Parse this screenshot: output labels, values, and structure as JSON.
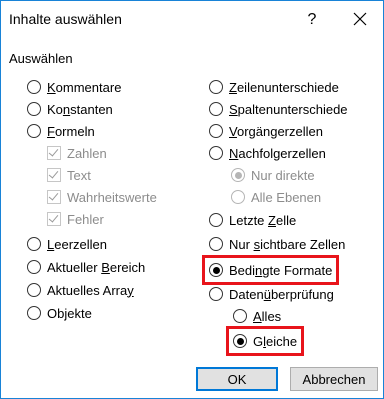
{
  "window": {
    "title": "Inhalte auswählen",
    "help": "?",
    "close_icon": "close-icon"
  },
  "group": {
    "label": "Auswählen"
  },
  "left_options": [
    {
      "pre": "",
      "u": "K",
      "post": "ommentare"
    },
    {
      "pre": "Ko",
      "u": "n",
      "post": "stanten"
    },
    {
      "pre": "",
      "u": "F",
      "post": "ormeln"
    },
    {
      "label": "Zahlen"
    },
    {
      "label": "Text"
    },
    {
      "label": "Wahrheitswerte"
    },
    {
      "label": "Fehler"
    },
    {
      "pre": "",
      "u": "L",
      "post": "eerzellen"
    },
    {
      "pre": "Aktueller ",
      "u": "B",
      "post": "ereich"
    },
    {
      "pre": "Aktuelles Arra",
      "u": "y",
      "post": ""
    },
    {
      "pre": "Ob",
      "u": "j",
      "post": "ekte"
    }
  ],
  "right_options": [
    {
      "pre": "",
      "u": "Z",
      "post": "eilenunterschiede"
    },
    {
      "pre": "",
      "u": "S",
      "post": "paltenunterschiede"
    },
    {
      "pre": "",
      "u": "V",
      "post": "orgängerzellen"
    },
    {
      "pre": "",
      "u": "N",
      "post": "achfolgerzellen"
    },
    {
      "pre": "",
      "u": "N",
      "post": "ur direkte"
    },
    {
      "pre": "Alle ",
      "u": "E",
      "post": "benen"
    },
    {
      "pre": "Letzte ",
      "u": "Z",
      "post": "elle"
    },
    {
      "pre": "Nur ",
      "u": "s",
      "post": "ichtbare Zellen"
    },
    {
      "pre": "Bedi",
      "u": "n",
      "post": "gte Formate"
    },
    {
      "pre": "Daten",
      "u": "ü",
      "post": "berprüfung"
    },
    {
      "pre": "",
      "u": "A",
      "post": "lles"
    },
    {
      "pre": "G",
      "u": "l",
      "post": "eiche"
    }
  ],
  "buttons": {
    "ok": "OK",
    "cancel": "Abbrechen"
  },
  "colors": {
    "highlight": "#e8141b",
    "accent": "#0078d7"
  }
}
